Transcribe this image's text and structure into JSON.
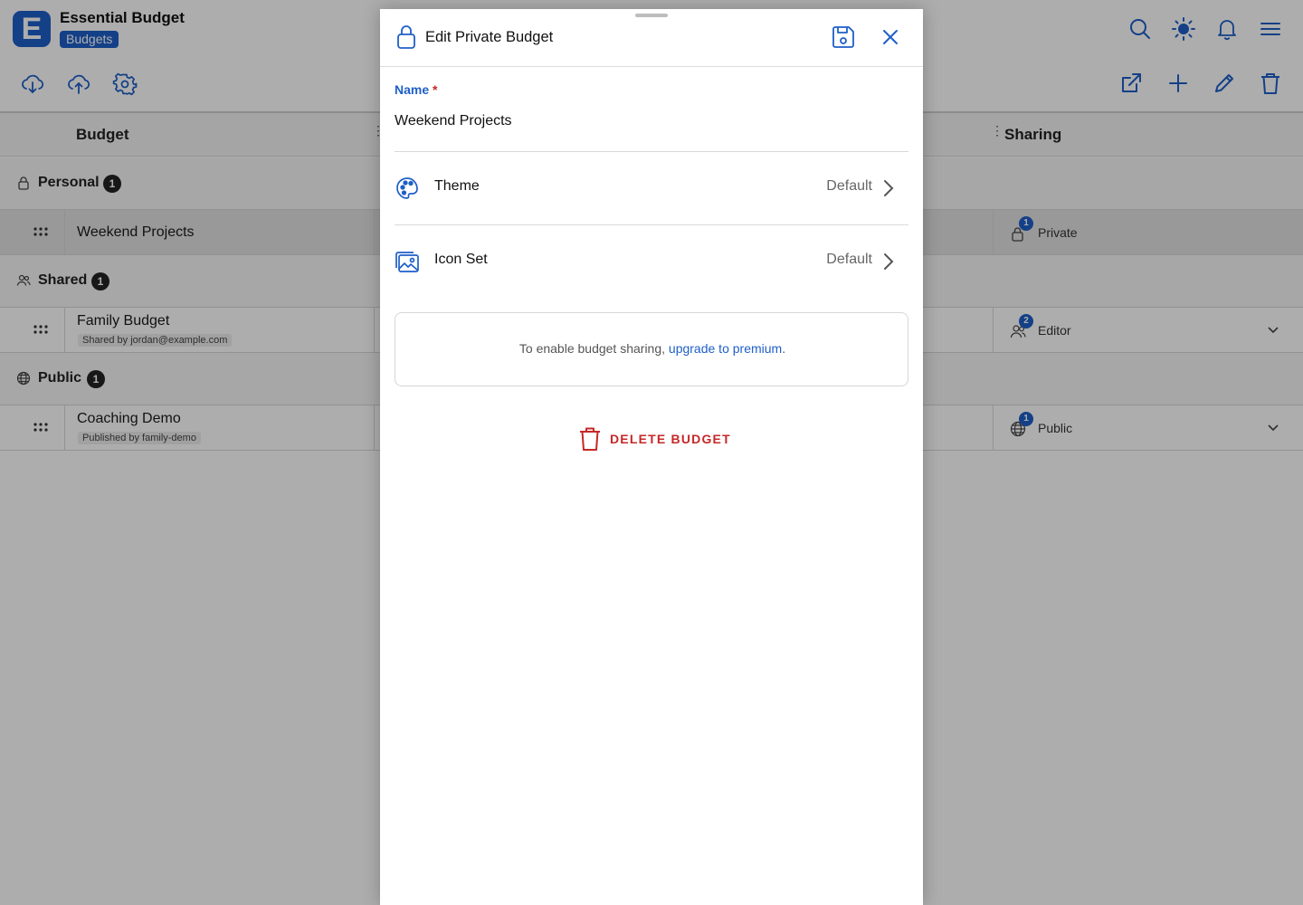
{
  "app": {
    "logo_letter": "E",
    "title": "Essential Budget",
    "badge": "Budgets"
  },
  "toolbar": {
    "left_icons": [
      "cloud-download-icon",
      "cloud-upload-icon",
      "settings-icon"
    ],
    "right_top_icons": [
      "search-icon",
      "brightness-icon",
      "bell-icon",
      "menu-icon"
    ],
    "right_actions": [
      "open-external-icon",
      "add-icon",
      "edit-icon",
      "delete-icon"
    ]
  },
  "table": {
    "col_budget": "Budget",
    "col_sharing": "Sharing",
    "groups": [
      {
        "label": "Personal",
        "count": "1"
      },
      {
        "label": "Shared",
        "count": "1"
      },
      {
        "label": "Public",
        "count": "1"
      }
    ],
    "rows": [
      {
        "name": "Weekend Projects",
        "sub": "",
        "share_badge": "1",
        "share_label": "Private"
      },
      {
        "name": "Family Budget",
        "sub": "Shared by jordan@example.com",
        "share_badge": "2",
        "share_label": "Editor"
      },
      {
        "name": "Coaching Demo",
        "sub": "Published by family-demo",
        "share_badge": "1",
        "share_label": "Public"
      }
    ]
  },
  "modal": {
    "title": "Edit Private Budget",
    "name_label": "Name",
    "required_mark": "*",
    "name_value": "Weekend Projects",
    "theme_label": "Theme",
    "theme_value": "Default",
    "iconset_label": "Icon Set",
    "iconset_value": "Default",
    "note_text": "To enable budget sharing, ",
    "note_link": "upgrade to premium",
    "note_end": ".",
    "delete_label": "DELETE BUDGET"
  },
  "colors": {
    "accent": "#1e5fc8",
    "danger": "#c62828",
    "overlay": "rgba(0,0,0,0.32)"
  }
}
